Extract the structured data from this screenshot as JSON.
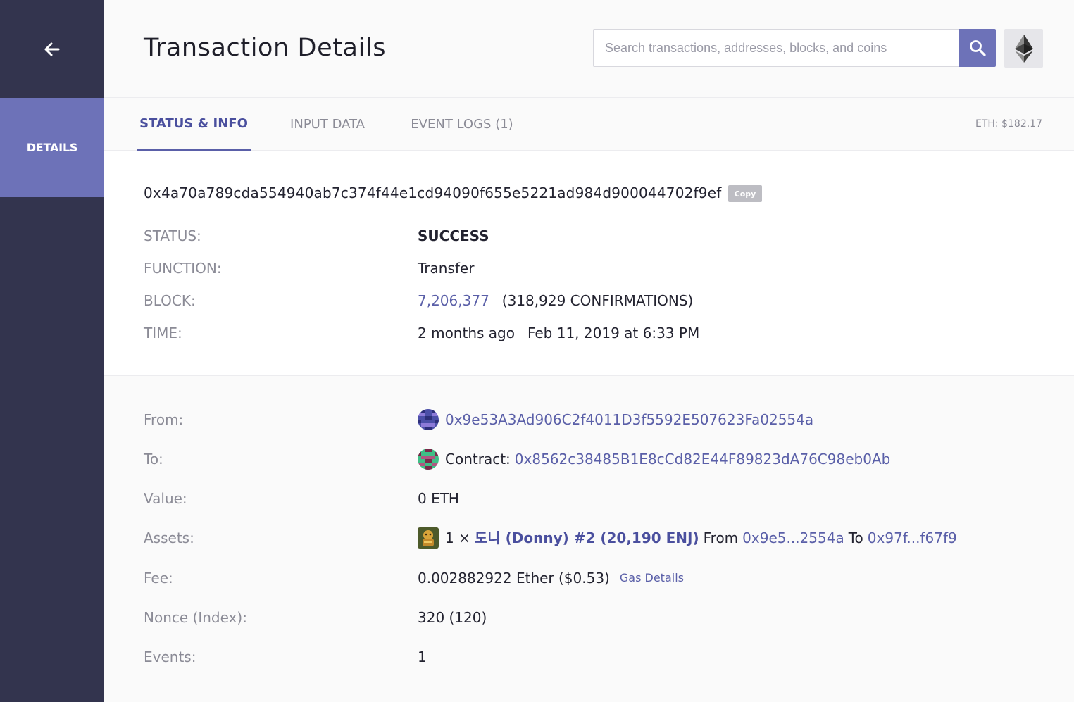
{
  "sidebar": {
    "back_icon": "arrow-left-icon",
    "nav_details": "DETAILS"
  },
  "header": {
    "title": "Transaction Details",
    "search_placeholder": "Search transactions, addresses, blocks, and coins",
    "search_icon": "search-icon",
    "network_icon": "ethereum-icon"
  },
  "tabs": [
    {
      "label": "STATUS & INFO",
      "active": true
    },
    {
      "label": "INPUT DATA",
      "active": false
    },
    {
      "label": "EVENT LOGS (1)",
      "active": false
    }
  ],
  "eth_price": "ETH: $182.17",
  "colors": {
    "sidebar": "#33344e",
    "accent": "#6d72b8",
    "link": "#5a5fa8",
    "success": "#2d9e8a"
  },
  "tx": {
    "hash": "0x4a70a789cda554940ab7c374f44e1cd94090f655e5221ad984d900044702f9ef",
    "copy_label": "Copy",
    "status_label": "STATUS:",
    "status_value": "SUCCESS",
    "function_label": "FUNCTION:",
    "function_value": "Transfer",
    "block_label": "BLOCK:",
    "block_value": "7,206,377",
    "block_confirmations": "(318,929 CONFIRMATIONS)",
    "time_label": "TIME:",
    "time_relative": "2 months ago",
    "time_absolute": "Feb 11, 2019 at 6:33 PM"
  },
  "details": {
    "from_label": "From:",
    "from_address": "0x9e53A3Ad906C2f4011D3f5592E507623Fa02554a",
    "to_label": "To:",
    "to_prefix": "Contract:",
    "to_address": "0x8562c38485B1E8cCd82E44F89823dA76C98eb0Ab",
    "value_label": "Value:",
    "value": "0 ETH",
    "assets_label": "Assets:",
    "asset_qty": "1 ×",
    "asset_name": "도니 (Donny) #2 (20,190 ENJ)",
    "asset_from_text": "From",
    "asset_from": "0x9e5...2554a",
    "asset_to_text": "To",
    "asset_to": "0x97f...f67f9",
    "fee_label": "Fee:",
    "fee_value": "0.002882922 Ether ($0.53)",
    "gas_details": "Gas Details",
    "nonce_label": "Nonce (Index):",
    "nonce_value": "320 (120)",
    "events_label": "Events:",
    "events_value": "1"
  }
}
